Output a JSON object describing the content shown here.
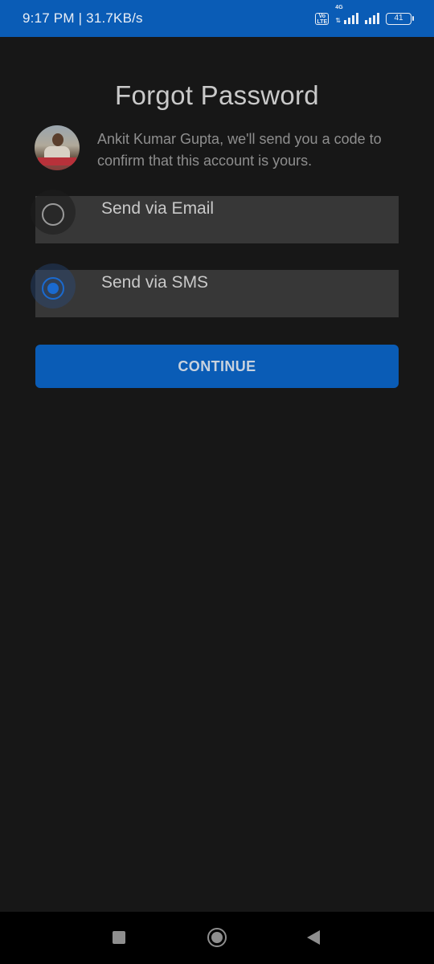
{
  "status_bar": {
    "time_speed": "9:17 PM | 31.7KB/s",
    "volte_label": "Vo LTE",
    "network_type": "4G",
    "battery_level": "41",
    "signal_icons": [
      "signal-sim1-icon",
      "signal-sim2-icon"
    ]
  },
  "screen": {
    "title": "Forgot Password",
    "message": "Ankit Kumar Gupta, we'll send you a code to confirm that this account is yours."
  },
  "options": [
    {
      "label": "Send via Email",
      "selected": false
    },
    {
      "label": "Send via SMS",
      "selected": true
    }
  ],
  "continue_button": {
    "label": "CONTINUE"
  },
  "colors": {
    "accent": "#0a5cb6",
    "radio_selected": "#1a6ad0",
    "background": "#171717",
    "option_background": "#373737"
  },
  "nav_bar": {
    "icons": [
      "recent-apps-icon",
      "home-icon",
      "back-icon"
    ]
  }
}
